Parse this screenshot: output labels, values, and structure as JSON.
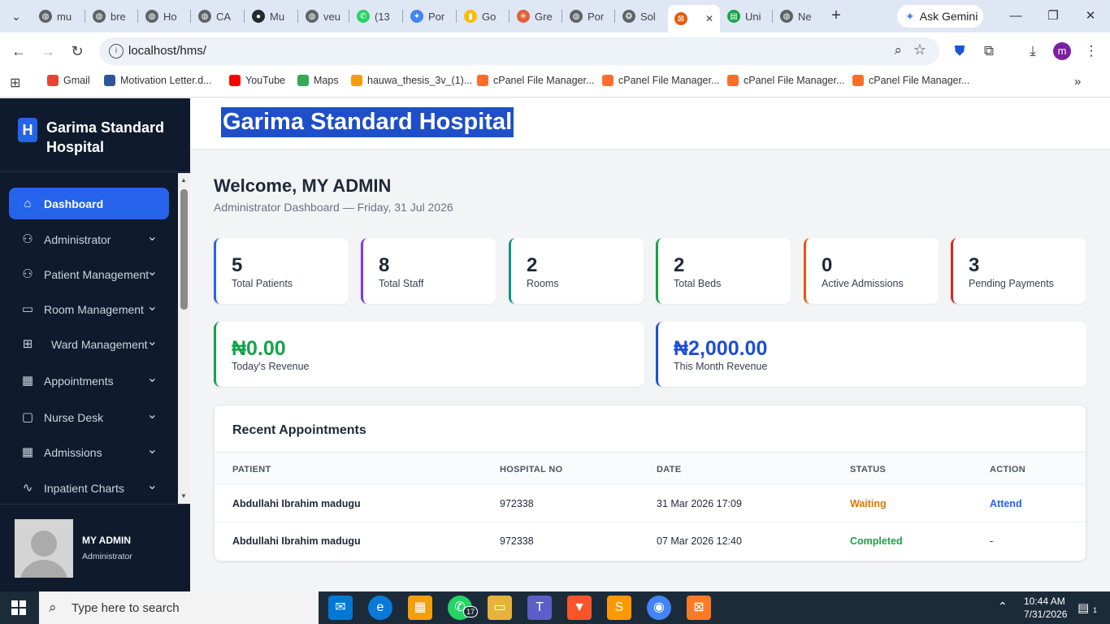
{
  "browser": {
    "tabs": [
      {
        "label": "mu",
        "color": "#5f6368",
        "icon": "globe-icon"
      },
      {
        "label": "bre",
        "color": "#5f6368",
        "icon": "globe-icon"
      },
      {
        "label": "Ho",
        "color": "#5f6368",
        "icon": "globe-icon"
      },
      {
        "label": "CA",
        "color": "#5f6368",
        "icon": "globe-icon"
      },
      {
        "label": "Mu",
        "color": "#24292e",
        "icon": "github-icon"
      },
      {
        "label": "veu",
        "color": "#5f6368",
        "icon": "globe-icon"
      },
      {
        "label": "(13",
        "color": "#25d366",
        "icon": "whatsapp-icon"
      },
      {
        "label": "Por",
        "color": "#4285f4",
        "icon": "gemini-icon"
      },
      {
        "label": "Go",
        "color": "#fbbc04",
        "icon": "google-icon"
      },
      {
        "label": "Gre",
        "color": "#e0603c",
        "icon": "claude-icon"
      },
      {
        "label": "Por",
        "color": "#5f6368",
        "icon": "globe-icon"
      },
      {
        "label": "Sol",
        "color": "#5f6368",
        "icon": "openai-icon"
      },
      {
        "label": "",
        "color": "#ea580c",
        "icon": "xampp-icon",
        "active": true
      },
      {
        "label": "Uni",
        "color": "#16a34a",
        "icon": "doc-icon"
      },
      {
        "label": "Ne",
        "color": "#5f6368",
        "icon": "globe-icon"
      }
    ],
    "ask_gemini": "Ask Gemini",
    "url": "localhost/hms/",
    "bookmarks": [
      {
        "label": "Gmail",
        "color": "#ea4335"
      },
      {
        "label": "Motivation Letter.d...",
        "color": "#2b579a"
      },
      {
        "label": "YouTube",
        "color": "#ff0000"
      },
      {
        "label": "Maps",
        "color": "#34a853"
      },
      {
        "label": "hauwa_thesis_3v_(1)...",
        "color": "#f59e0b"
      },
      {
        "label": "cPanel File Manager...",
        "color": "#ff6c2c"
      },
      {
        "label": "cPanel File Manager...",
        "color": "#ff6c2c"
      },
      {
        "label": "cPanel File Manager...",
        "color": "#ff6c2c"
      },
      {
        "label": "cPanel File Manager...",
        "color": "#ff6c2c"
      }
    ],
    "profile_initial": "m"
  },
  "sidebar": {
    "logo_letter": "H",
    "brand": "Garima Standard Hospital",
    "items": [
      {
        "label": "Dashboard",
        "icon": "home-icon",
        "active": true
      },
      {
        "label": "Administrator",
        "icon": "users-icon"
      },
      {
        "label": "Patient Management",
        "icon": "users-icon"
      },
      {
        "label": "Room Management",
        "icon": "bed-icon"
      },
      {
        "label": "Ward Management",
        "icon": "plus-square-icon"
      },
      {
        "label": "Appointments",
        "icon": "calendar-icon"
      },
      {
        "label": "Nurse Desk",
        "icon": "clipboard-icon"
      },
      {
        "label": "Admissions",
        "icon": "calendar-plus-icon"
      },
      {
        "label": "Inpatient Charts",
        "icon": "activity-icon"
      }
    ],
    "user": {
      "name": "MY ADMIN",
      "role": "Administrator"
    }
  },
  "header": {
    "title": "Garima Standard Hospital"
  },
  "main": {
    "welcome": "Welcome, MY ADMIN",
    "subtitle": "Administrator Dashboard — Friday, 31 Jul 2026",
    "stats": [
      {
        "value": "5",
        "label": "Total Patients",
        "color": "#2563eb"
      },
      {
        "value": "8",
        "label": "Total Staff",
        "color": "#7c3aed"
      },
      {
        "value": "2",
        "label": "Rooms",
        "color": "#0d9488"
      },
      {
        "value": "2",
        "label": "Total Beds",
        "color": "#16a34a"
      },
      {
        "value": "0",
        "label": "Active Admissions",
        "color": "#ea580c"
      },
      {
        "value": "3",
        "label": "Pending Payments",
        "color": "#dc2626"
      }
    ],
    "revenue": [
      {
        "value": "₦0.00",
        "label": "Today's Revenue",
        "color": "#16a34a"
      },
      {
        "value": "₦2,000.00",
        "label": "This Month Revenue",
        "color": "#1d4ed8"
      }
    ],
    "appointments": {
      "title": "Recent Appointments",
      "columns": [
        "PATIENT",
        "HOSPITAL NO",
        "DATE",
        "STATUS",
        "ACTION"
      ],
      "rows": [
        {
          "patient": "Abdullahi Ibrahim madugu",
          "hospital_no": "972338",
          "date": "31 Mar 2026 17:09",
          "status": "Waiting",
          "action": "Attend"
        },
        {
          "patient": "Abdullahi Ibrahim madugu",
          "hospital_no": "972338",
          "date": "07 Mar 2026 12:40",
          "status": "Completed",
          "action": "-"
        }
      ]
    }
  },
  "taskbar": {
    "search_placeholder": "Type here to search",
    "whatsapp_badge": "17",
    "time": "10:44 AM",
    "date": "7/31/2026",
    "notifications": "1"
  }
}
